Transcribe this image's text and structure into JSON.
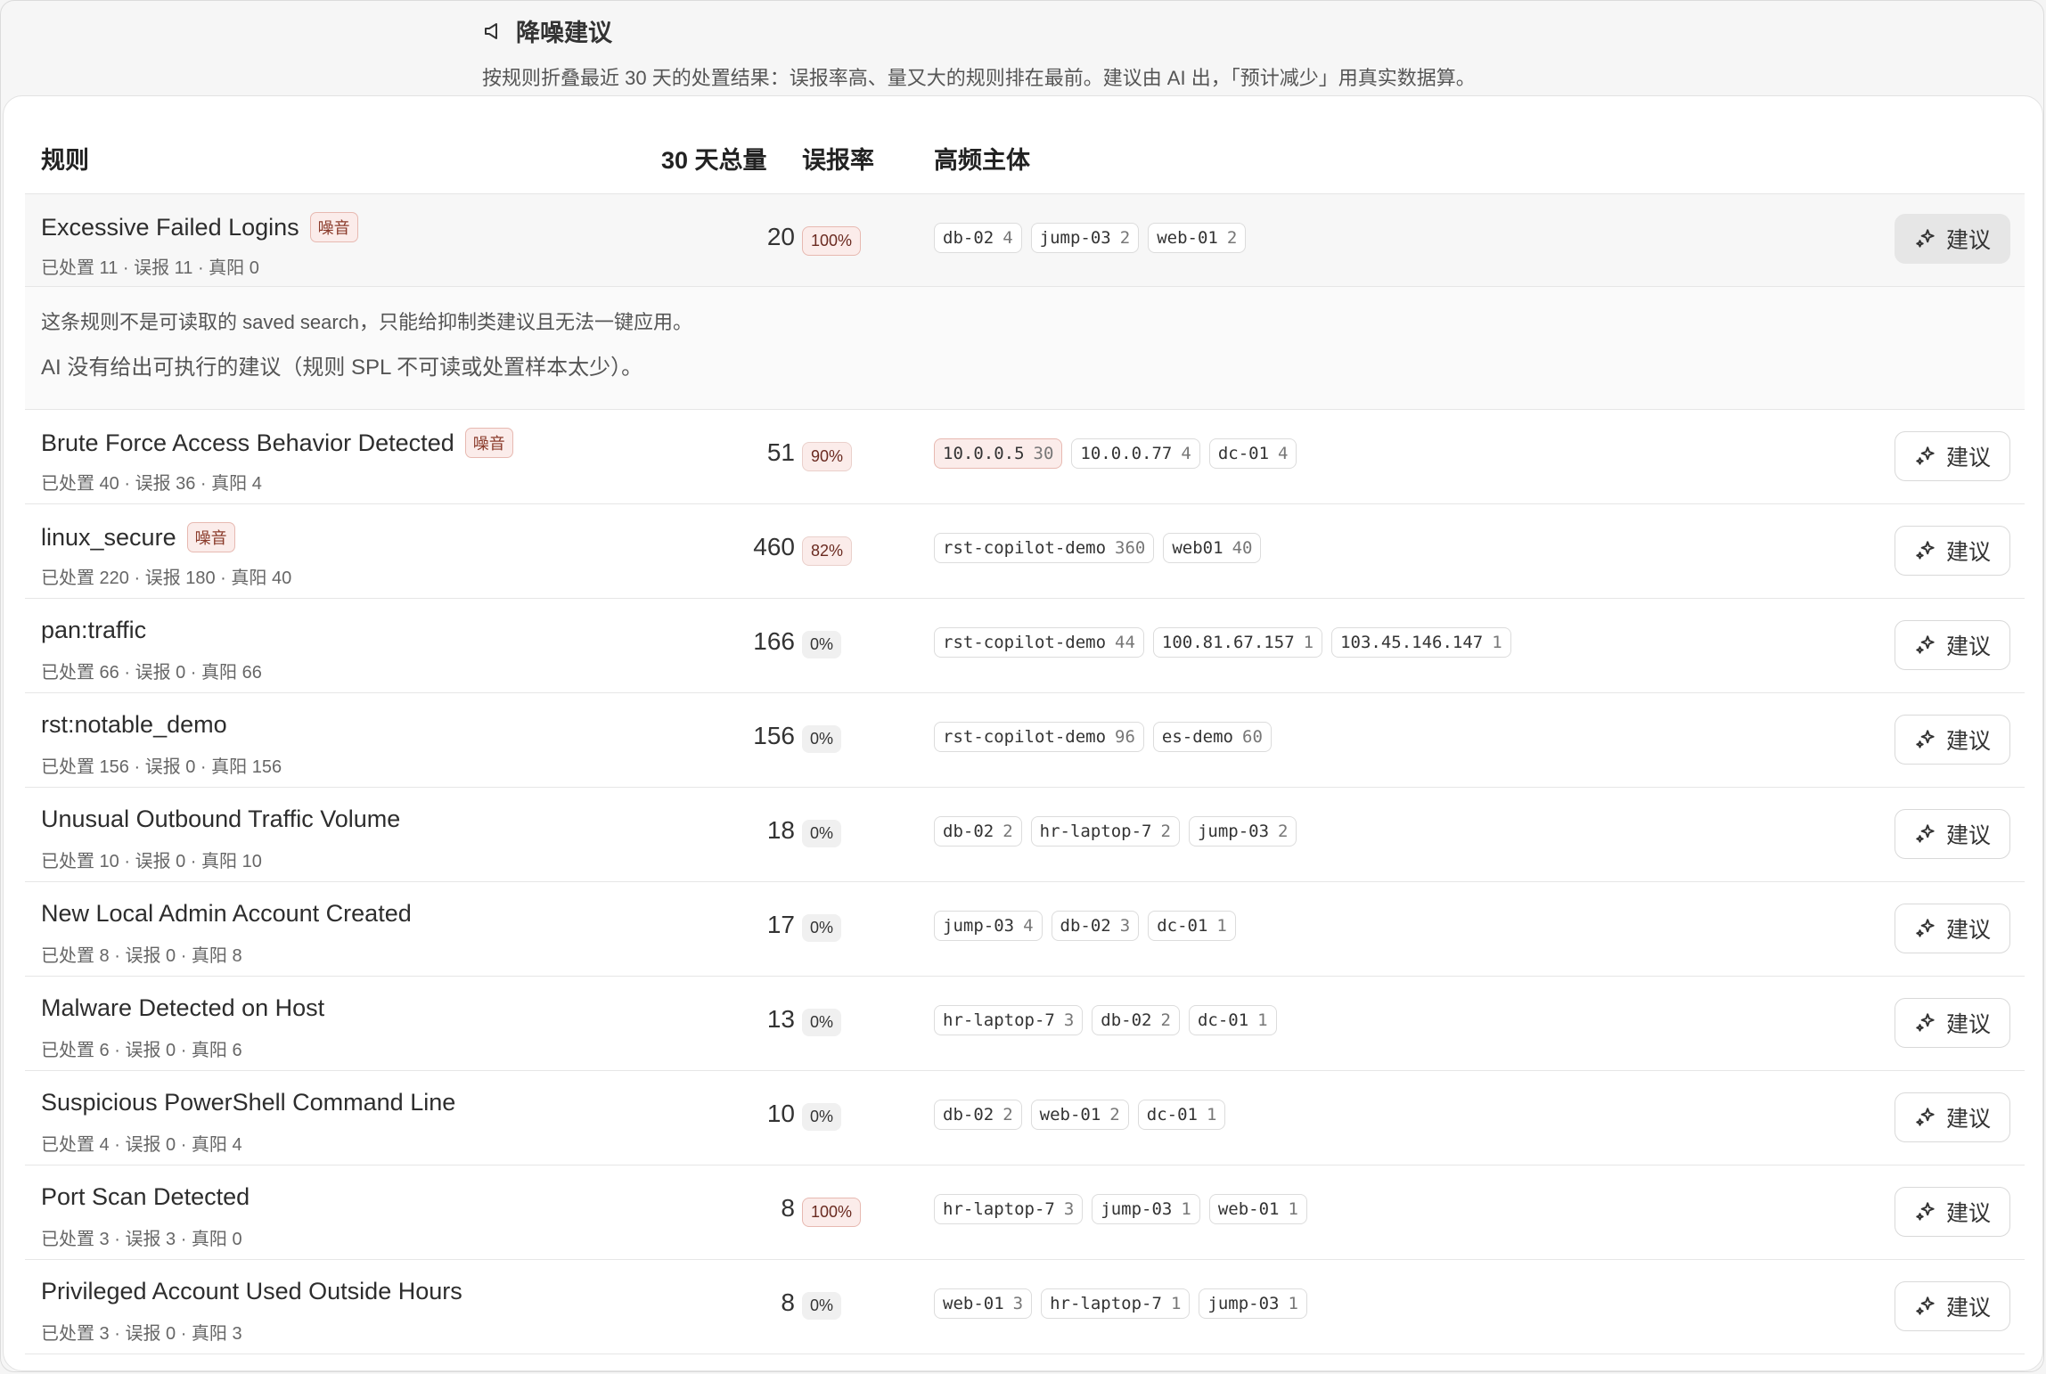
{
  "header": {
    "title": "降噪建议",
    "description": "按规则折叠最近 30 天的处置结果：误报率高、量又大的规则排在最前。建议由 AI 出，「预计减少」用真实数据算。"
  },
  "table": {
    "columns": {
      "rule": "规则",
      "total": "30 天总量",
      "fp_rate": "误报率",
      "entities": "高频主体"
    },
    "suggest_label": "建议",
    "noise_badge": "噪音",
    "rows": [
      {
        "name": "Excessive Failed Logins",
        "noise": true,
        "sub": "已处置 11 · 误报 11 · 真阳 0",
        "total": "20",
        "rate": "100%",
        "rate_level": "hot",
        "entities": [
          {
            "host": "db-02",
            "count": "4"
          },
          {
            "host": "jump-03",
            "count": "2"
          },
          {
            "host": "web-01",
            "count": "2"
          }
        ]
      },
      {
        "name": "Brute Force Access Behavior Detected",
        "noise": true,
        "sub": "已处置 40 · 误报 36 · 真阳 4",
        "total": "51",
        "rate": "90%",
        "rate_level": "warn",
        "entities": [
          {
            "host": "10.0.0.5",
            "count": "30",
            "hot": true
          },
          {
            "host": "10.0.0.77",
            "count": "4"
          },
          {
            "host": "dc-01",
            "count": "4"
          }
        ]
      },
      {
        "name": "linux_secure",
        "noise": true,
        "sub": "已处置 220 · 误报 180 · 真阳 40",
        "total": "460",
        "rate": "82%",
        "rate_level": "warn",
        "entities": [
          {
            "host": "rst-copilot-demo",
            "count": "360"
          },
          {
            "host": "web01",
            "count": "40"
          }
        ]
      },
      {
        "name": "pan:traffic",
        "noise": false,
        "sub": "已处置 66 · 误报 0 · 真阳 66",
        "total": "166",
        "rate": "0%",
        "rate_level": "low",
        "entities": [
          {
            "host": "rst-copilot-demo",
            "count": "44"
          },
          {
            "host": "100.81.67.157",
            "count": "1"
          },
          {
            "host": "103.45.146.147",
            "count": "1"
          }
        ]
      },
      {
        "name": "rst:notable_demo",
        "noise": false,
        "sub": "已处置 156 · 误报 0 · 真阳 156",
        "total": "156",
        "rate": "0%",
        "rate_level": "low",
        "entities": [
          {
            "host": "rst-copilot-demo",
            "count": "96"
          },
          {
            "host": "es-demo",
            "count": "60"
          }
        ]
      },
      {
        "name": "Unusual Outbound Traffic Volume",
        "noise": false,
        "sub": "已处置 10 · 误报 0 · 真阳 10",
        "total": "18",
        "rate": "0%",
        "rate_level": "low",
        "entities": [
          {
            "host": "db-02",
            "count": "2"
          },
          {
            "host": "hr-laptop-7",
            "count": "2"
          },
          {
            "host": "jump-03",
            "count": "2"
          }
        ]
      },
      {
        "name": "New Local Admin Account Created",
        "noise": false,
        "sub": "已处置 8 · 误报 0 · 真阳 8",
        "total": "17",
        "rate": "0%",
        "rate_level": "low",
        "entities": [
          {
            "host": "jump-03",
            "count": "4"
          },
          {
            "host": "db-02",
            "count": "3"
          },
          {
            "host": "dc-01",
            "count": "1"
          }
        ]
      },
      {
        "name": "Malware Detected on Host",
        "noise": false,
        "sub": "已处置 6 · 误报 0 · 真阳 6",
        "total": "13",
        "rate": "0%",
        "rate_level": "low",
        "entities": [
          {
            "host": "hr-laptop-7",
            "count": "3"
          },
          {
            "host": "db-02",
            "count": "2"
          },
          {
            "host": "dc-01",
            "count": "1"
          }
        ]
      },
      {
        "name": "Suspicious PowerShell Command Line",
        "noise": false,
        "sub": "已处置 4 · 误报 0 · 真阳 4",
        "total": "10",
        "rate": "0%",
        "rate_level": "low",
        "entities": [
          {
            "host": "db-02",
            "count": "2"
          },
          {
            "host": "web-01",
            "count": "2"
          },
          {
            "host": "dc-01",
            "count": "1"
          }
        ]
      },
      {
        "name": "Port Scan Detected",
        "noise": false,
        "sub": "已处置 3 · 误报 3 · 真阳 0",
        "total": "8",
        "rate": "100%",
        "rate_level": "hot",
        "entities": [
          {
            "host": "hr-laptop-7",
            "count": "3"
          },
          {
            "host": "jump-03",
            "count": "1"
          },
          {
            "host": "web-01",
            "count": "1"
          }
        ]
      },
      {
        "name": "Privileged Account Used Outside Hours",
        "noise": false,
        "sub": "已处置 3 · 误报 0 · 真阳 3",
        "total": "8",
        "rate": "0%",
        "rate_level": "low",
        "entities": [
          {
            "host": "web-01",
            "count": "3"
          },
          {
            "host": "hr-laptop-7",
            "count": "1"
          },
          {
            "host": "jump-03",
            "count": "1"
          }
        ]
      }
    ],
    "expanded_detail": {
      "note": "这条规则不是可读取的 saved search，只能给抑制类建议且无法一键应用。",
      "message": "AI 没有给出可执行的建议（规则 SPL 不可读或处置样本太少）。"
    }
  },
  "icons": {
    "header": "speaker-icon",
    "suggest": "sparkle-icon"
  }
}
